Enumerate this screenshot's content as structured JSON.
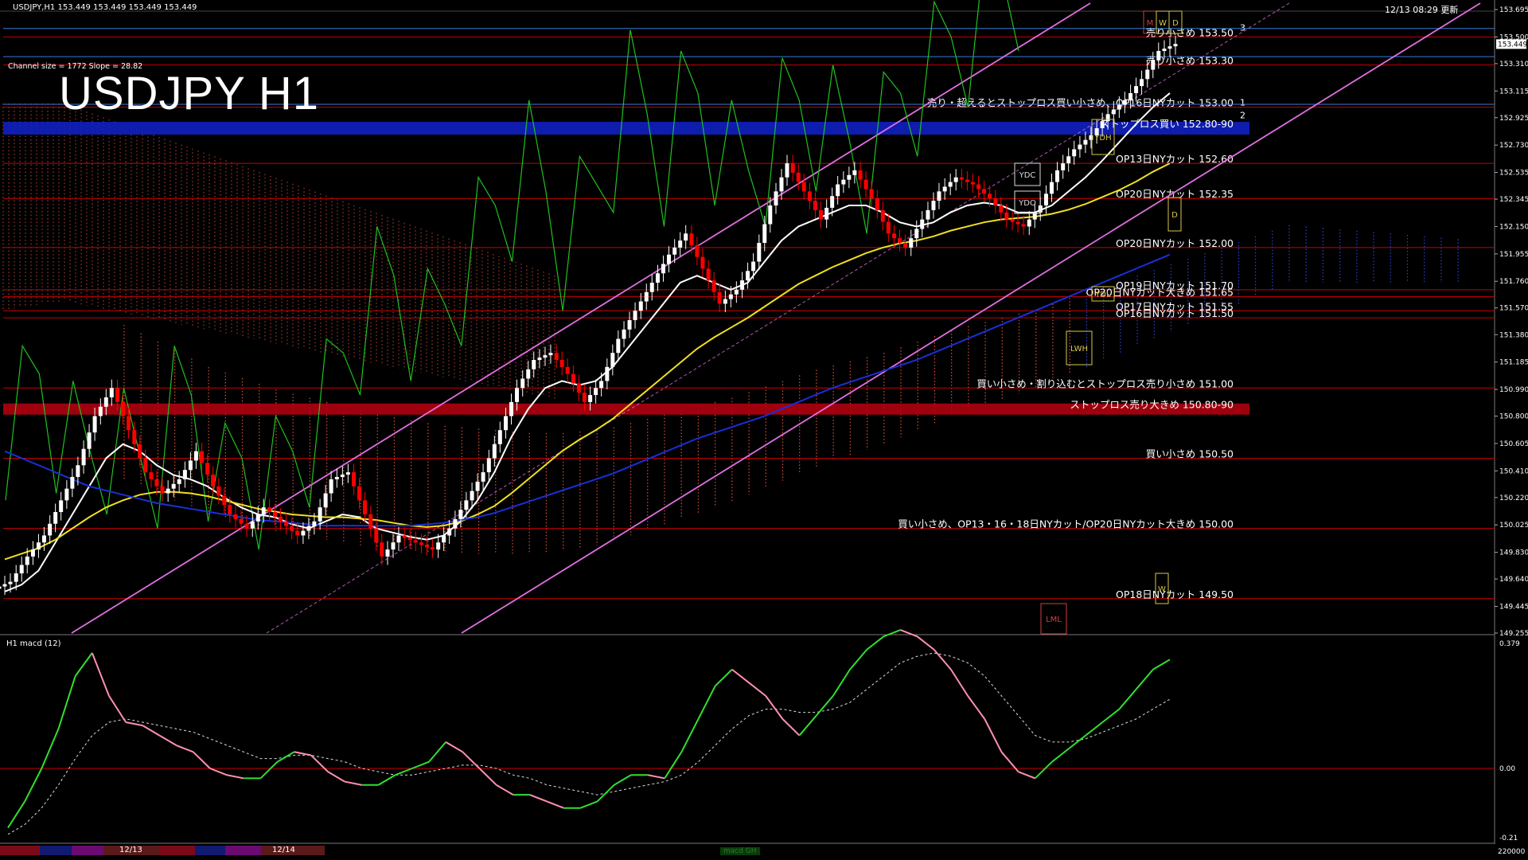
{
  "window": {
    "header_text": "USDJPY,H1  153.449 153.449 153.449 153.449",
    "datetime": "12/13 08:29 更新",
    "title": "USDJPY H1",
    "channel_info": "Channel size = 1772 Slope = 28.82"
  },
  "colors": {
    "background": "#000000",
    "bull_candle": "#ffffff",
    "bear_candle": "#ff0000",
    "channel": "#e070e0",
    "ma_white": "#ffffff",
    "ma_yellow": "#f0e020",
    "ma_blue": "#1a2fd8",
    "chikou_green": "#20c020",
    "cloud_red": "#ff6040",
    "cloud_blue": "#3050ff",
    "level_line": "#cc0000",
    "macd_main": "#30e030",
    "macd_down": "#ff90b0"
  },
  "chart_data": [
    {
      "type": "line",
      "title": "USDJPY H1",
      "ylim": [
        149.255,
        153.695
      ],
      "y_ticks": [
        "153.695",
        "153.500",
        "153.310",
        "153.115",
        "152.925",
        "152.730",
        "152.535",
        "152.345",
        "152.150",
        "151.955",
        "151.760",
        "151.570",
        "151.380",
        "151.185",
        "150.990",
        "150.800",
        "150.605",
        "150.410",
        "150.220",
        "150.025",
        "149.830",
        "149.640",
        "149.445",
        "149.255"
      ],
      "current_price": "153.449",
      "x_labels": [
        "12/13",
        "12/14"
      ],
      "series": [
        {
          "name": "",
          "kind": "close",
          "values": [
            149.62,
            149.8,
            149.95,
            150.2,
            150.45,
            150.8,
            151.0,
            150.7,
            150.4,
            150.25,
            150.35,
            150.55,
            150.3,
            150.1,
            150.0,
            150.15,
            150.05,
            149.95,
            150.05,
            150.35,
            150.4,
            150.1,
            149.8,
            149.95,
            149.9,
            149.85,
            150.0,
            150.2,
            150.4,
            150.7,
            151.0,
            151.2,
            151.25,
            151.1,
            150.9,
            151.05,
            151.35,
            151.55,
            151.75,
            151.95,
            152.1,
            151.85,
            151.6,
            151.7,
            151.9,
            152.3,
            152.6,
            152.4,
            152.2,
            152.45,
            152.55,
            152.35,
            152.1,
            152.0,
            152.2,
            152.4,
            152.5,
            152.45,
            152.35,
            152.2,
            152.15,
            152.3,
            152.55,
            152.7,
            152.8,
            152.95,
            153.05,
            153.2,
            153.4,
            153.45
          ]
        },
        {
          "name": "",
          "kind": "ma-fast",
          "values": [
            149.55,
            149.6,
            149.7,
            149.9,
            150.1,
            150.3,
            150.5,
            150.6,
            150.55,
            150.45,
            150.38,
            150.35,
            150.3,
            150.22,
            150.15,
            150.1,
            150.08,
            150.03,
            150.0,
            150.05,
            150.1,
            150.08,
            150.0,
            149.97,
            149.94,
            149.92,
            149.95,
            150.05,
            150.2,
            150.4,
            150.65,
            150.85,
            151.0,
            151.05,
            151.02,
            151.05,
            151.15,
            151.3,
            151.45,
            151.6,
            151.75,
            151.8,
            151.75,
            151.7,
            151.75,
            151.9,
            152.05,
            152.15,
            152.2,
            152.25,
            152.3,
            152.3,
            152.25,
            152.18,
            152.15,
            152.18,
            152.25,
            152.3,
            152.32,
            152.3,
            152.25,
            152.25,
            152.3,
            152.4,
            152.5,
            152.62,
            152.75,
            152.88,
            153.0,
            153.1
          ]
        },
        {
          "name": "",
          "kind": "ma-mid",
          "values": [
            149.78,
            149.82,
            149.86,
            149.92,
            150.0,
            150.08,
            150.15,
            150.2,
            150.24,
            150.26,
            150.26,
            150.25,
            150.23,
            150.2,
            150.17,
            150.14,
            150.12,
            150.1,
            150.09,
            150.08,
            150.08,
            150.07,
            150.06,
            150.04,
            150.02,
            150.01,
            150.02,
            150.05,
            150.1,
            150.16,
            150.25,
            150.35,
            150.45,
            150.55,
            150.63,
            150.7,
            150.78,
            150.88,
            150.98,
            151.08,
            151.18,
            151.28,
            151.36,
            151.43,
            151.5,
            151.58,
            151.66,
            151.74,
            151.8,
            151.86,
            151.91,
            151.96,
            152.0,
            152.03,
            152.05,
            152.08,
            152.12,
            152.15,
            152.18,
            152.2,
            152.21,
            152.22,
            152.24,
            152.27,
            152.31,
            152.36,
            152.41,
            152.47,
            152.54,
            152.6
          ]
        },
        {
          "name": "",
          "kind": "ma-slow",
          "values": [
            150.55,
            150.5,
            150.45,
            150.4,
            150.35,
            150.3,
            150.27,
            150.24,
            150.21,
            150.18,
            150.16,
            150.14,
            150.12,
            150.1,
            150.08,
            150.06,
            150.05,
            150.04,
            150.03,
            150.02,
            150.02,
            150.02,
            150.02,
            150.02,
            150.02,
            150.03,
            150.04,
            150.06,
            150.08,
            150.11,
            150.15,
            150.19,
            150.23,
            150.27,
            150.31,
            150.35,
            150.39,
            150.44,
            150.49,
            150.54,
            150.59,
            150.64,
            150.68,
            150.72,
            150.76,
            150.8,
            150.85,
            150.9,
            150.95,
            151.0,
            151.04,
            151.08,
            151.12,
            151.16,
            151.2,
            151.25,
            151.3,
            151.35,
            151.4,
            151.45,
            151.5,
            151.55,
            151.6,
            151.65,
            151.7,
            151.75,
            151.8,
            151.85,
            151.9,
            151.95
          ]
        }
      ],
      "annotations": [
        {
          "price": 153.5,
          "text": "売り小さめ 153.50",
          "num": "3"
        },
        {
          "price": 153.3,
          "text": "売り小さめ 153.30",
          "num": ""
        },
        {
          "price": 153.0,
          "text": "売り・超えるとストップロス買い小さめ、OP16日NYカット 153.00",
          "num": "1"
        },
        {
          "price": 152.85,
          "text": "ストップロス買い 152.80-90",
          "num": "",
          "band": "blue"
        },
        {
          "price": 152.6,
          "text": "OP13日NYカット 152.60",
          "num": ""
        },
        {
          "price": 152.35,
          "text": "OP20日NYカット 152.35",
          "num": ""
        },
        {
          "price": 152.0,
          "text": "OP20日NYカット 152.00",
          "num": ""
        },
        {
          "price": 151.7,
          "text": "OP19日NYカット 151.70",
          "num": ""
        },
        {
          "price": 151.65,
          "text": "OP20日NYカット大きめ 151.65",
          "num": ""
        },
        {
          "price": 151.55,
          "text": "OP17日NYカット 151.55",
          "num": ""
        },
        {
          "price": 151.5,
          "text": "OP16日NYカット 151.50",
          "num": ""
        },
        {
          "price": 151.0,
          "text": "買い小さめ・割り込むとストップロス売り小さめ 151.00",
          "num": ""
        },
        {
          "price": 150.85,
          "text": "ストップロス売り大きめ 150.80-90",
          "num": "",
          "band": "red"
        },
        {
          "price": 150.5,
          "text": "買い小さめ 150.50",
          "num": ""
        },
        {
          "price": 150.0,
          "text": "買い小さめ、OP13・16・18日NYカット/OP20日NYカット大きめ 150.00",
          "num": ""
        },
        {
          "price": 149.5,
          "text": "OP18日NYカット 149.50",
          "num": ""
        }
      ],
      "tags": [
        "M",
        "W",
        "D",
        "YDH",
        "YDC",
        "YDO",
        "YDL",
        "LWH",
        "LML",
        "D",
        "W"
      ],
      "extra_label_2": "2"
    },
    {
      "type": "line",
      "title": "H1  macd (12)",
      "ylim": [
        -0.21,
        0.379
      ],
      "y_ticks": [
        "0.379",
        "0.00",
        "-0.21"
      ],
      "series": [
        {
          "name": "",
          "kind": "macd",
          "values": [
            -0.18,
            -0.1,
            0.0,
            0.12,
            0.28,
            0.35,
            0.22,
            0.14,
            0.13,
            0.1,
            0.07,
            0.05,
            0.0,
            -0.02,
            -0.03,
            -0.03,
            0.02,
            0.05,
            0.04,
            -0.01,
            -0.04,
            -0.05,
            -0.05,
            -0.02,
            0.0,
            0.02,
            0.08,
            0.05,
            0.0,
            -0.05,
            -0.08,
            -0.08,
            -0.1,
            -0.12,
            -0.12,
            -0.1,
            -0.05,
            -0.02,
            -0.02,
            -0.03,
            0.05,
            0.15,
            0.25,
            0.3,
            0.26,
            0.22,
            0.15,
            0.1,
            0.16,
            0.22,
            0.3,
            0.36,
            0.4,
            0.42,
            0.4,
            0.36,
            0.3,
            0.22,
            0.15,
            0.05,
            -0.01,
            -0.03,
            0.02,
            0.06,
            0.1,
            0.14,
            0.18,
            0.24,
            0.3,
            0.33
          ]
        },
        {
          "name": "",
          "kind": "signal",
          "values": [
            -0.2,
            -0.17,
            -0.12,
            -0.05,
            0.03,
            0.1,
            0.14,
            0.15,
            0.14,
            0.13,
            0.12,
            0.11,
            0.09,
            0.07,
            0.05,
            0.03,
            0.03,
            0.04,
            0.04,
            0.03,
            0.02,
            0.0,
            -0.01,
            -0.02,
            -0.02,
            -0.01,
            0.0,
            0.01,
            0.01,
            0.0,
            -0.02,
            -0.03,
            -0.05,
            -0.06,
            -0.07,
            -0.08,
            -0.07,
            -0.06,
            -0.05,
            -0.04,
            -0.02,
            0.02,
            0.07,
            0.12,
            0.16,
            0.18,
            0.18,
            0.17,
            0.17,
            0.18,
            0.2,
            0.24,
            0.28,
            0.32,
            0.34,
            0.35,
            0.34,
            0.32,
            0.28,
            0.22,
            0.16,
            0.1,
            0.08,
            0.08,
            0.09,
            0.11,
            0.13,
            0.15,
            0.18,
            0.21
          ]
        }
      ]
    }
  ],
  "bottom_bar": {
    "labels": [
      "12/13",
      "12/14",
      "macd GH"
    ],
    "right_value": "220000"
  }
}
